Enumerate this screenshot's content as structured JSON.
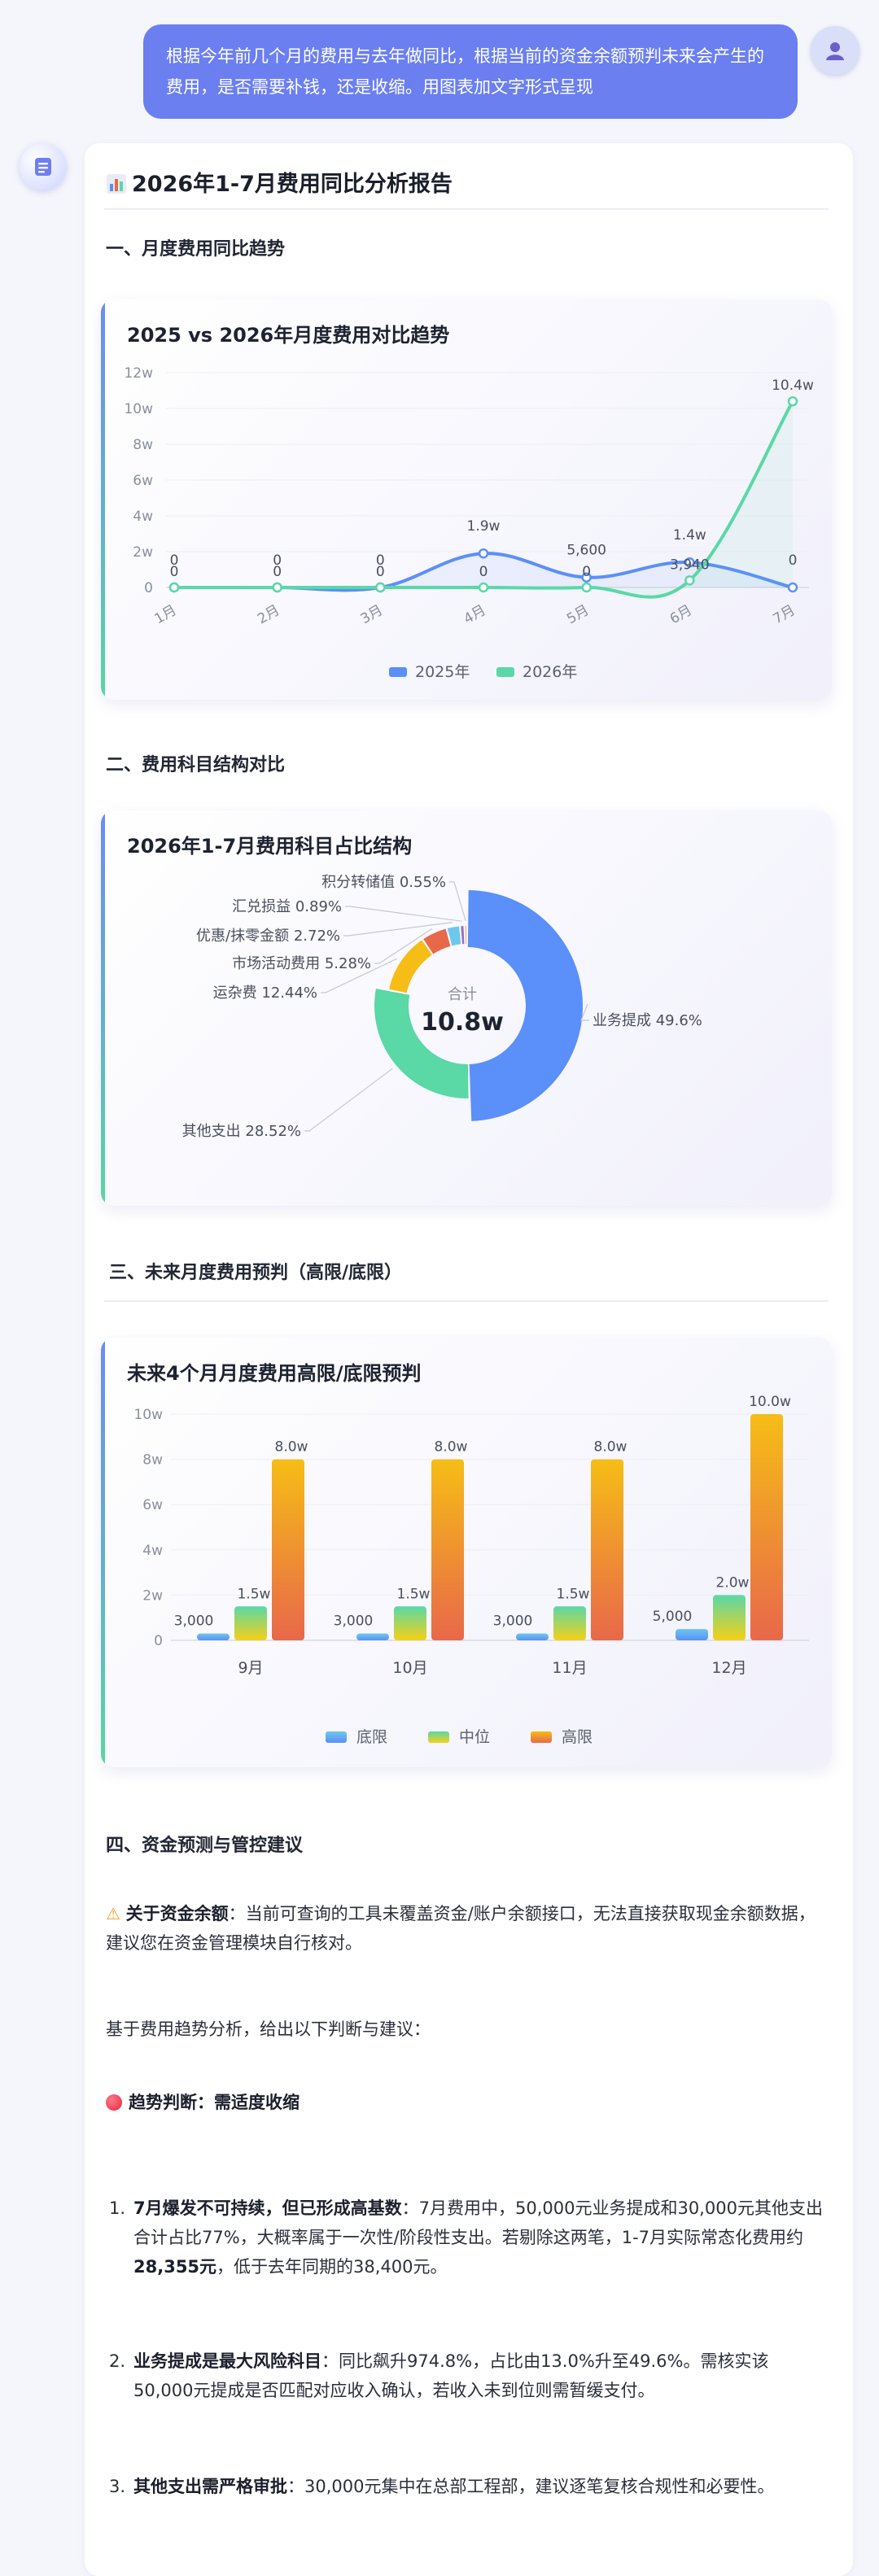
{
  "user_message": "根据今年前几个月的费用与去年做同比，根据当前的资金余额预判未来会产生的费用，是否需要补钱，还是收缩。用图表加文字形式呈现",
  "report": {
    "title_icon": "bar-chart-icon",
    "title": "2026年1-7月费用同比分析报告"
  },
  "sections": {
    "s1": "一、月度费用同比趋势",
    "s2": "二、费用科目结构对比",
    "s3": "三、未来月度费用预判（高限/底限）",
    "s4": "四、资金预测与管控建议"
  },
  "chart_data": [
    {
      "type": "line",
      "title": "2025 vs 2026年月度费用对比趋势",
      "x": [
        "1月",
        "2月",
        "3月",
        "4月",
        "5月",
        "6月",
        "7月"
      ],
      "yticks": [
        "0",
        "2w",
        "4w",
        "6w",
        "8w",
        "10w",
        "12w"
      ],
      "ylim": [
        0,
        120000
      ],
      "grid": true,
      "legend_position": "bottom",
      "series": [
        {
          "name": "2025年",
          "color": "#5b8ff9",
          "values": [
            0,
            0,
            0,
            19000,
            5600,
            14000,
            0
          ],
          "labels": [
            "0",
            "0",
            "0",
            "1.9w",
            "5,600",
            "1.4w",
            "0"
          ]
        },
        {
          "name": "2026年",
          "color": "#5ad8a6",
          "values": [
            0,
            0,
            0,
            0,
            0,
            3940,
            104000
          ],
          "labels": [
            "0",
            "0",
            "0",
            "0",
            "0",
            "3,940",
            "10.4w"
          ]
        }
      ]
    },
    {
      "type": "pie",
      "title": "2026年1-7月费用科目占比结构",
      "center_label": "合计",
      "center_value": "10.8w",
      "slices": [
        {
          "name": "业务提成",
          "value": 49.6,
          "label": "业务提成 49.6%",
          "color": "#5b8ff9"
        },
        {
          "name": "其他支出",
          "value": 28.52,
          "label": "其他支出 28.52%",
          "color": "#5ad8a6"
        },
        {
          "name": "运杂费",
          "value": 12.44,
          "label": "运杂费 12.44%",
          "color": "#f6bd16"
        },
        {
          "name": "市场活动费用",
          "value": 5.28,
          "label": "市场活动费用 5.28%",
          "color": "#e8684a"
        },
        {
          "name": "优惠/抹零金额",
          "value": 2.72,
          "label": "优惠/抹零金额 2.72%",
          "color": "#6dc8ec"
        },
        {
          "name": "汇兑损益",
          "value": 0.89,
          "label": "汇兑损益 0.89%",
          "color": "#9270ca"
        },
        {
          "name": "积分转储值",
          "value": 0.55,
          "label": "积分转储值 0.55%",
          "color": "#ff9d4d"
        }
      ]
    },
    {
      "type": "bar",
      "title": "未来4个月月度费用高限/底限预判",
      "categories": [
        "9月",
        "10月",
        "11月",
        "12月"
      ],
      "yticks": [
        "0",
        "2w",
        "4w",
        "6w",
        "8w",
        "10w"
      ],
      "ylim": [
        0,
        100000
      ],
      "legend_position": "bottom",
      "series": [
        {
          "name": "底限",
          "values": [
            3000,
            3000,
            3000,
            5000
          ],
          "labels": [
            "3,000",
            "3,000",
            "3,000",
            "5,000"
          ],
          "color_top": "#6dc8ec",
          "color_bottom": "#5b8ff9"
        },
        {
          "name": "中位",
          "values": [
            15000,
            15000,
            15000,
            20000
          ],
          "labels": [
            "1.5w",
            "1.5w",
            "1.5w",
            "2.0w"
          ],
          "color_top": "#5ad8a6",
          "color_bottom": "#f6d016"
        },
        {
          "name": "高限",
          "values": [
            80000,
            80000,
            80000,
            100000
          ],
          "labels": [
            "8.0w",
            "8.0w",
            "8.0w",
            "10.0w"
          ],
          "color_top": "#f6bd16",
          "color_bottom": "#e8684a"
        }
      ]
    }
  ],
  "notes": {
    "balance_icon": "warning-icon",
    "balance_label": "关于资金余额",
    "balance_text": "：当前可查询的工具未覆盖资金/账户余额接口，无法直接获取现金余额数据，建议您在资金管理模块自行核对。",
    "intro": "基于费用趋势分析，给出以下判断与建议：",
    "trend_icon": "red-circle-icon",
    "trend_label": "趋势判断：需适度收缩"
  },
  "items": [
    {
      "num": "1.",
      "bold": "7月爆发不可持续，但已形成高基数",
      "text": "：7月费用中，50,000元业务提成和30,000元其他支出合计占比77%，大概率属于一次性/阶段性支出。若剔除这两笔，1-7月实际常态化费用约 ",
      "bold2": "28,355元",
      "text2": "，低于去年同期的38,400元。"
    },
    {
      "num": "2.",
      "bold": "业务提成是最大风险科目",
      "text": "：同比飙升974.8%，占比由13.0%升至49.6%。需核实该50,000元提成是否匹配对应收入确认，若收入未到位则需暂缓支付。",
      "bold2": "",
      "text2": ""
    },
    {
      "num": "3.",
      "bold": "其他支出需严格审批",
      "text": "：30,000元集中在总部工程部，建议逐笔复核合规性和必要性。",
      "bold2": "",
      "text2": ""
    }
  ]
}
